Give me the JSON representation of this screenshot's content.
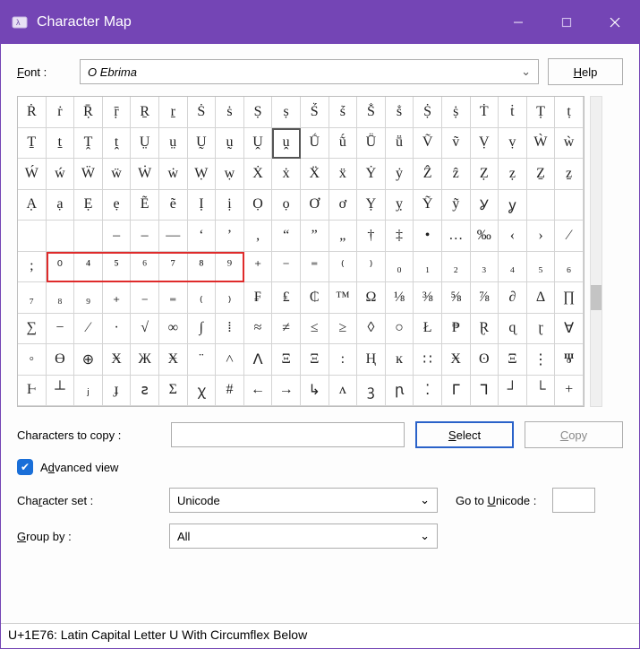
{
  "titlebar": {
    "title": "Character Map"
  },
  "font_row": {
    "label": "Font :",
    "font_name": "Ebrima",
    "help_label": "Help"
  },
  "grid": {
    "selected_index": 29,
    "highlight": {
      "row": 5,
      "col_start": 1,
      "col_end": 8
    },
    "rows": [
      [
        "Ṙ",
        "ṙ",
        "Ṝ",
        "ṝ",
        "Ṟ",
        "ṟ",
        "Ṡ",
        "ṡ",
        "Ṣ",
        "ṣ",
        "Ṥ",
        "ṥ",
        "Ṧ",
        "ṧ",
        "Ṩ",
        "ṩ",
        "Ṫ",
        "ṫ",
        "Ṭ",
        "ṭ"
      ],
      [
        "Ṯ",
        "ṯ",
        "Ṱ",
        "ṱ",
        "Ṳ",
        "ṳ",
        "Ṵ",
        "ṵ",
        "Ṷ",
        "ṷ",
        "Ṹ",
        "ṹ",
        "Ṻ",
        "ṻ",
        "Ṽ",
        "ṽ",
        "Ṿ",
        "ṿ",
        "Ẁ",
        "ẁ"
      ],
      [
        "Ẃ",
        "ẃ",
        "Ẅ",
        "ẅ",
        "Ẇ",
        "ẇ",
        "Ẉ",
        "ẉ",
        "Ẋ",
        "ẋ",
        "Ẍ",
        "ẍ",
        "Ẏ",
        "ẏ",
        "Ẑ",
        "ẑ",
        "Ẓ",
        "ẓ",
        "Ẕ",
        "ẕ"
      ],
      [
        "Ạ",
        "ạ",
        "Ẹ",
        "ẹ",
        "Ẽ",
        "ẽ",
        "Ị",
        "ị",
        "Ọ",
        "ọ",
        "Ơ",
        "ơ",
        "Ỵ",
        "ỵ",
        "Ỹ",
        "ỹ",
        "Ỿ",
        "ỿ",
        "",
        ""
      ],
      [
        "",
        "",
        "",
        "‒",
        "–",
        "—",
        "‘",
        "’",
        "‚",
        "“",
        "”",
        "„",
        "†",
        "‡",
        "•",
        "…",
        "‰",
        "‹",
        "›",
        "⁄"
      ],
      [
        ";",
        "⁰",
        "⁴",
        "⁵",
        "⁶",
        "⁷",
        "⁸",
        "⁹",
        "⁺",
        "⁻",
        "⁼",
        "⁽",
        "⁾",
        "₀",
        "₁",
        "₂",
        "₃",
        "₄",
        "₅",
        "₆"
      ],
      [
        "₇",
        "₈",
        "₉",
        "₊",
        "₋",
        "₌",
        "₍",
        "₎",
        "₣",
        "₤",
        "₵",
        "™",
        "Ω",
        "⅛",
        "⅜",
        "⅝",
        "⅞",
        "∂",
        "∆",
        "∏"
      ],
      [
        "∑",
        "−",
        "∕",
        "∙",
        "√",
        "∞",
        "∫",
        "⁞",
        "≈",
        "≠",
        "≤",
        "≥",
        "◊",
        "○",
        "Ł",
        "₱",
        "Ɽ",
        "ɋ",
        "ɽ",
        "∀"
      ],
      [
        "◦",
        "ϴ",
        "⊕",
        "Ӿ",
        "Ж",
        "Ӿ",
        "¨",
        "˄",
        "ꓥ",
        "Ξ",
        "Ξ",
        ":",
        "Ⱨ",
        "ĸ",
        "∷",
        "Ӿ",
        "ʘ",
        "Ξ",
        "⋮",
        "Ⱋ"
      ],
      [
        "Ⱶ",
        "┴",
        "ⱼ",
        "ɟ",
        "ꙅ",
        "Σ",
        "ꭓ",
        "#",
        "←",
        "→",
        "↳",
        "ʌ",
        "ꝫ",
        "ꞃ",
        "⁚",
        "ᒥ",
        "ᒣ",
        "┘",
        "└",
        "+"
      ]
    ]
  },
  "copy_row": {
    "label": "Characters to copy :",
    "value": "",
    "select_label": "Select",
    "copy_label": "Copy"
  },
  "advanced": {
    "checked": true,
    "label": "Advanced view"
  },
  "charset_row": {
    "label": "Character set :",
    "value": "Unicode",
    "goto_label": "Go to Unicode :",
    "goto_value": ""
  },
  "groupby_row": {
    "label": "Group by :",
    "value": "All"
  },
  "status": "U+1E76: Latin Capital Letter U With Circumflex Below"
}
